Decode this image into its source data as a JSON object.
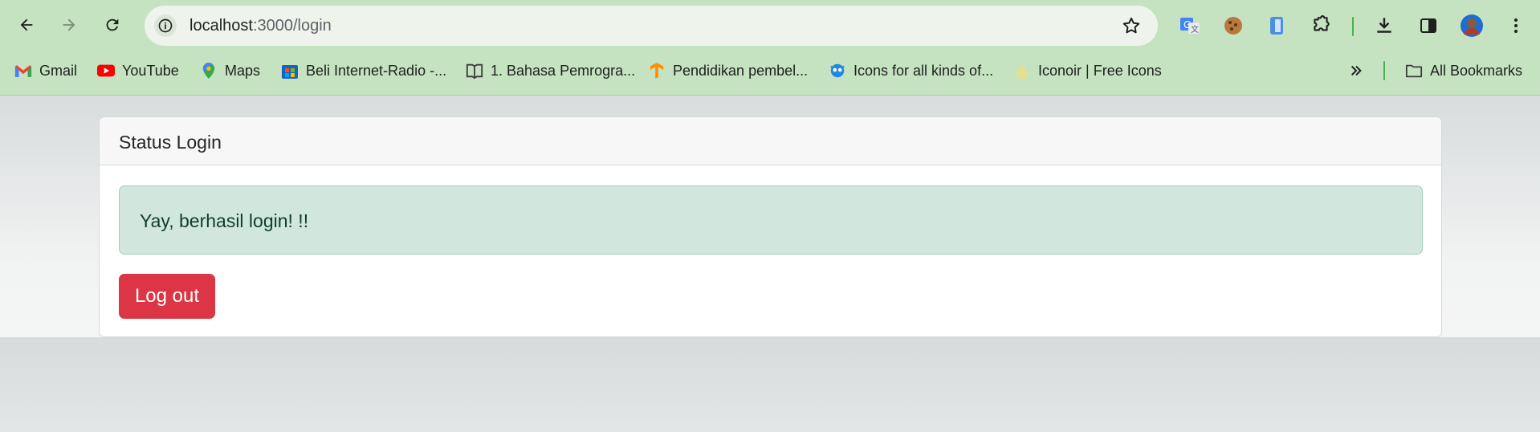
{
  "browser": {
    "url_host": "localhost",
    "url_path": ":3000/login",
    "bookmarks": [
      {
        "label": "Gmail",
        "icon": "gmail-icon"
      },
      {
        "label": "YouTube",
        "icon": "youtube-icon"
      },
      {
        "label": "Maps",
        "icon": "maps-icon"
      },
      {
        "label": "Beli Internet-Radio -...",
        "icon": "store-icon"
      },
      {
        "label": "1. Bahasa Pemrogra...",
        "icon": "book-icon"
      },
      {
        "label": "Pendidikan pembel...",
        "icon": "tensorflow-icon"
      },
      {
        "label": "Icons for all kinds of...",
        "icon": "icons-site-icon"
      },
      {
        "label": "Iconoir | Free Icons",
        "icon": "iconoir-icon"
      }
    ],
    "all_bookmarks_label": "All Bookmarks"
  },
  "card": {
    "title": "Status Login",
    "alert_text": "Yay, berhasil login! !!",
    "logout_label": "Log out"
  },
  "colors": {
    "chrome_bg": "#c5e2c1",
    "alert_bg": "#d1e7dd",
    "danger": "#dc3545"
  }
}
